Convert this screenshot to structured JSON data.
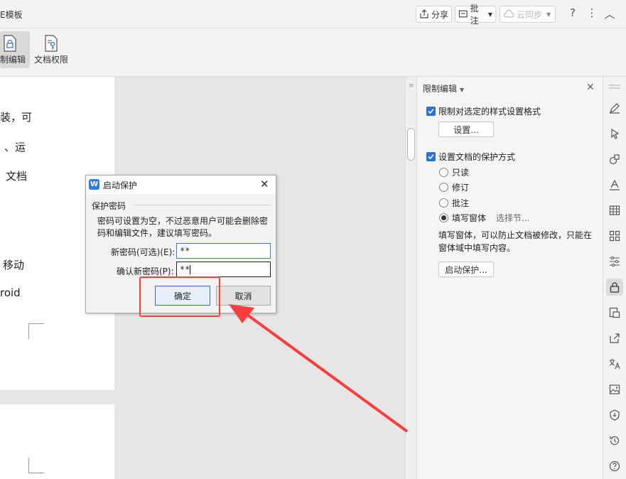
{
  "titlebar": {
    "doc_title": "E模板",
    "share_label": "分享",
    "comment_label": "批注",
    "cloud_sync_label": "云同步",
    "help_icon": "question-icon",
    "more_icon": "more-icon",
    "collapse_icon": "chevron-up-icon"
  },
  "ribbon": {
    "restrict_edit_label": "制编辑",
    "doc_permission_label": "文档权限"
  },
  "document": {
    "lines": [
      "装，可",
      "、运",
      "文档",
      "移动",
      "roid"
    ]
  },
  "panel": {
    "title": "限制编辑",
    "format_restrict_label": "限制对选定的样式设置格式",
    "settings_button": "设置...",
    "protect_mode_label": "设置文档的保护方式",
    "options": [
      "只读",
      "修订",
      "批注",
      "填写窗体"
    ],
    "select_section_link": "选择节...",
    "note": "填写窗体，可以防止文档被修改，只能在窗体域中填写内容。",
    "start_protect_button": "启动保护..."
  },
  "dialog": {
    "title": "启动保护",
    "section": "保护密码",
    "description": "密码可设置为空，不过恶意用户可能会删除密码和编辑文件，建议填写密码。",
    "new_password_label": "新密码(可选)(E):",
    "new_password_value": "**",
    "confirm_password_label": "确认新密码(P):",
    "confirm_password_value": "**",
    "ok_button": "确定",
    "cancel_button": "取消"
  },
  "colors": {
    "accent": "#2f6fd8",
    "annotation": "#ff3b3b"
  }
}
